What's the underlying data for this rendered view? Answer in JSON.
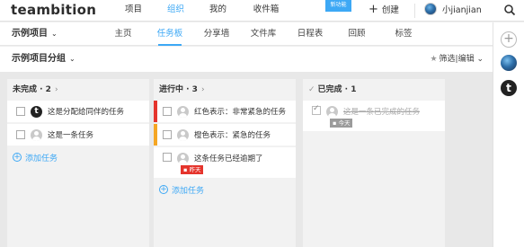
{
  "app": {
    "logo": "teambition"
  },
  "topnav": [
    {
      "label": "项目"
    },
    {
      "label": "组织"
    },
    {
      "label": "我的"
    },
    {
      "label": "收件箱"
    }
  ],
  "badge": "新功能",
  "create": {
    "label": "创建"
  },
  "user": {
    "name": "小jianjian"
  },
  "project": {
    "name": "示例项目"
  },
  "tabs": [
    {
      "label": "主页"
    },
    {
      "label": "任务板"
    },
    {
      "label": "分享墙"
    },
    {
      "label": "文件库"
    },
    {
      "label": "日程表"
    },
    {
      "label": "回顾"
    },
    {
      "label": "标签"
    }
  ],
  "group": {
    "name": "示例项目分组"
  },
  "filter": {
    "label": "筛选|编辑"
  },
  "columns": [
    {
      "title": "未完成 · 2",
      "cards": [
        {
          "text": "这是分配给同伴的任务"
        },
        {
          "text": "这是一条任务"
        }
      ],
      "add_label": "添加任务"
    },
    {
      "title": "进行中 · 3",
      "cards": [
        {
          "text": "红色表示：非常紧急的任务",
          "priority_color": "#e5342c"
        },
        {
          "text": "橙色表示：紧急的任务",
          "priority_color": "#f5a623"
        },
        {
          "text": "这条任务已经逾期了",
          "due": "昨天"
        }
      ],
      "add_label": "添加任务"
    },
    {
      "title": "已完成 · 1",
      "cards": [
        {
          "text": "这是一条已完成的任务",
          "due": "今天"
        }
      ]
    }
  ],
  "colors": {
    "accent": "#3da8f5",
    "urgent": "#e5342c",
    "warning": "#f5a623"
  }
}
